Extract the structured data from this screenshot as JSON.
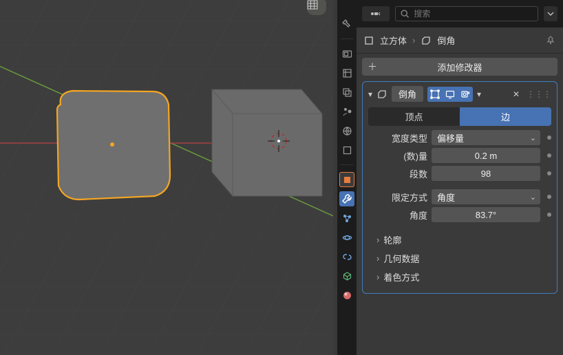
{
  "search": {
    "placeholder": "搜索"
  },
  "breadcrumb": {
    "object": "立方体",
    "modifier": "倒角"
  },
  "add_modifier_label": "添加修改器",
  "modifier": {
    "name": "倒角",
    "affect_vertex": "顶点",
    "affect_edge": "边",
    "width_type_label": "宽度类型",
    "width_type_value": "偏移量",
    "amount_label": "(数)量",
    "amount_value": "0.2 m",
    "segments_label": "段数",
    "segments_value": "98",
    "limit_method_label": "限定方式",
    "limit_method_value": "角度",
    "angle_label": "角度",
    "angle_value": "83.7°",
    "section_profile": "轮廓",
    "section_geometry": "几何数据",
    "section_shading": "着色方式"
  }
}
